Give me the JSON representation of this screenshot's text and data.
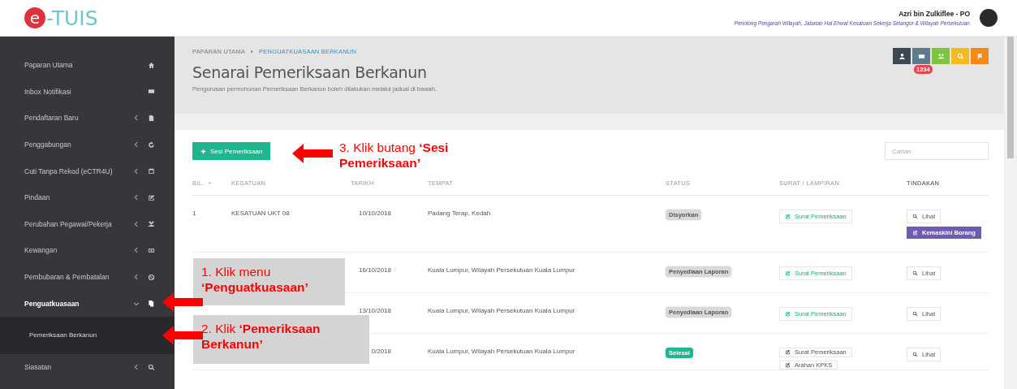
{
  "header": {
    "logo": {
      "mark": "e",
      "text": "-TUIS"
    },
    "user_name": "Azri bin Zulkiflee - PO",
    "user_role": "Penolong Pengarah Wilayah, Jabatan Hal Ehwal Kesatuan Sekerja Selangor & Wilayah Persekutuan"
  },
  "sidebar": {
    "items": [
      {
        "label": "Paparan Utama",
        "kind": "link",
        "selected": false
      },
      {
        "label": "Inbox Notifikasi",
        "kind": "link",
        "selected": false
      },
      {
        "label": "Pendaftaran Baru",
        "kind": "group",
        "expanded": false,
        "selected": false
      },
      {
        "label": "Penggabungan",
        "kind": "group",
        "expanded": false,
        "selected": false
      },
      {
        "label": "Cuti Tanpa Rekod (eCTR4U)",
        "kind": "group",
        "expanded": false,
        "selected": false
      },
      {
        "label": "Pindaan",
        "kind": "group",
        "expanded": false,
        "selected": false
      },
      {
        "label": "Perubahan Pegawai/Pekerja",
        "kind": "group",
        "expanded": false,
        "selected": false
      },
      {
        "label": "Kewangan",
        "kind": "group",
        "expanded": false,
        "selected": false
      },
      {
        "label": "Pembubaran & Pembatalan",
        "kind": "group",
        "expanded": false,
        "selected": false
      },
      {
        "label": "Penguatkuasaan",
        "kind": "group",
        "expanded": true,
        "selected": true,
        "children": [
          {
            "label": "Pemeriksaan Berkanun",
            "selected": true
          }
        ]
      },
      {
        "label": "Siasatan",
        "kind": "group",
        "expanded": false,
        "selected": false
      }
    ]
  },
  "toolbar": {
    "badge": "1234"
  },
  "page": {
    "breadcrumb": [
      "PAPARAN UTAMA",
      "PENGUATKUASAAN BERKANUN"
    ],
    "title": "Senarai Pemeriksaan Berkanun",
    "subtitle": "Pengurusan permohonan Pemeriksaan Berkanun boleh dilakukan melalui jadual di bawah.",
    "add_button": "Sesi Pemeriksaan",
    "search": {
      "placeholder": "Carian"
    }
  },
  "table": {
    "columns": [
      "BIL.",
      "KESATUAN",
      "TARIKH",
      "TEMPAT",
      "STATUS",
      "SURAT / LAMPIRAN",
      "TINDAKAN"
    ],
    "rows": [
      {
        "bil": "1",
        "kesatuan": "KESATUAN UKT 08",
        "tarikh": "10/10/2018",
        "tempat": "Padang Terap, Kedah",
        "status": {
          "label": "Disyorkan",
          "color": "#d9d9d9"
        },
        "documents": [
          {
            "label": "Surat Pemeriksaan",
            "kind": "primary"
          }
        ],
        "actions": [
          {
            "label": "Lihat",
            "kind": "view"
          },
          {
            "label": "Kemaskini Borang",
            "kind": "edit"
          }
        ]
      },
      {
        "tarikh": "16/10/2018",
        "tempat": "Kuala Lumpur, Wilayah Persekutuan Kuala Lumpur",
        "status": {
          "label": "Penyediaan Laporan",
          "color": "#d9d9d9"
        },
        "documents": [
          {
            "label": "Surat Pemeriksaan",
            "kind": "primary"
          }
        ],
        "actions": [
          {
            "label": "Lihat",
            "kind": "view"
          }
        ]
      },
      {
        "tarikh": "13/10/2018",
        "tempat": "Kuala Lumpur, Wilayah Persekutuan Kuala Lumpur",
        "status": {
          "label": "Penyediaan Laporan",
          "color": "#d9d9d9"
        },
        "documents": [
          {
            "label": "Surat Pemeriksaan",
            "kind": "primary"
          }
        ],
        "actions": [
          {
            "label": "Lihat",
            "kind": "view"
          }
        ]
      },
      {
        "tarikh": "0/2018",
        "tempat": "Kuala Lumpur, Wilayah Persekutuan Kuala Lumpur",
        "status": {
          "label": "Selesai",
          "color": "#1fb58f"
        },
        "documents": [
          {
            "label": "Surat Pemeriksaan",
            "kind": "default"
          },
          {
            "label": "Arahan KPKS",
            "kind": "default"
          }
        ],
        "actions": [
          {
            "label": "Lihat",
            "kind": "view"
          }
        ]
      }
    ]
  },
  "annotations": [
    {
      "text": "1. Klik menu **‘Penguatkuasaan’**",
      "boxed": true
    },
    {
      "text": "2. Klik **‘Pemeriksaan Berkanun’**",
      "boxed": true
    },
    {
      "text": "3. Klik butang **‘Sesi Pemeriksaan’**",
      "boxed": false
    }
  ]
}
